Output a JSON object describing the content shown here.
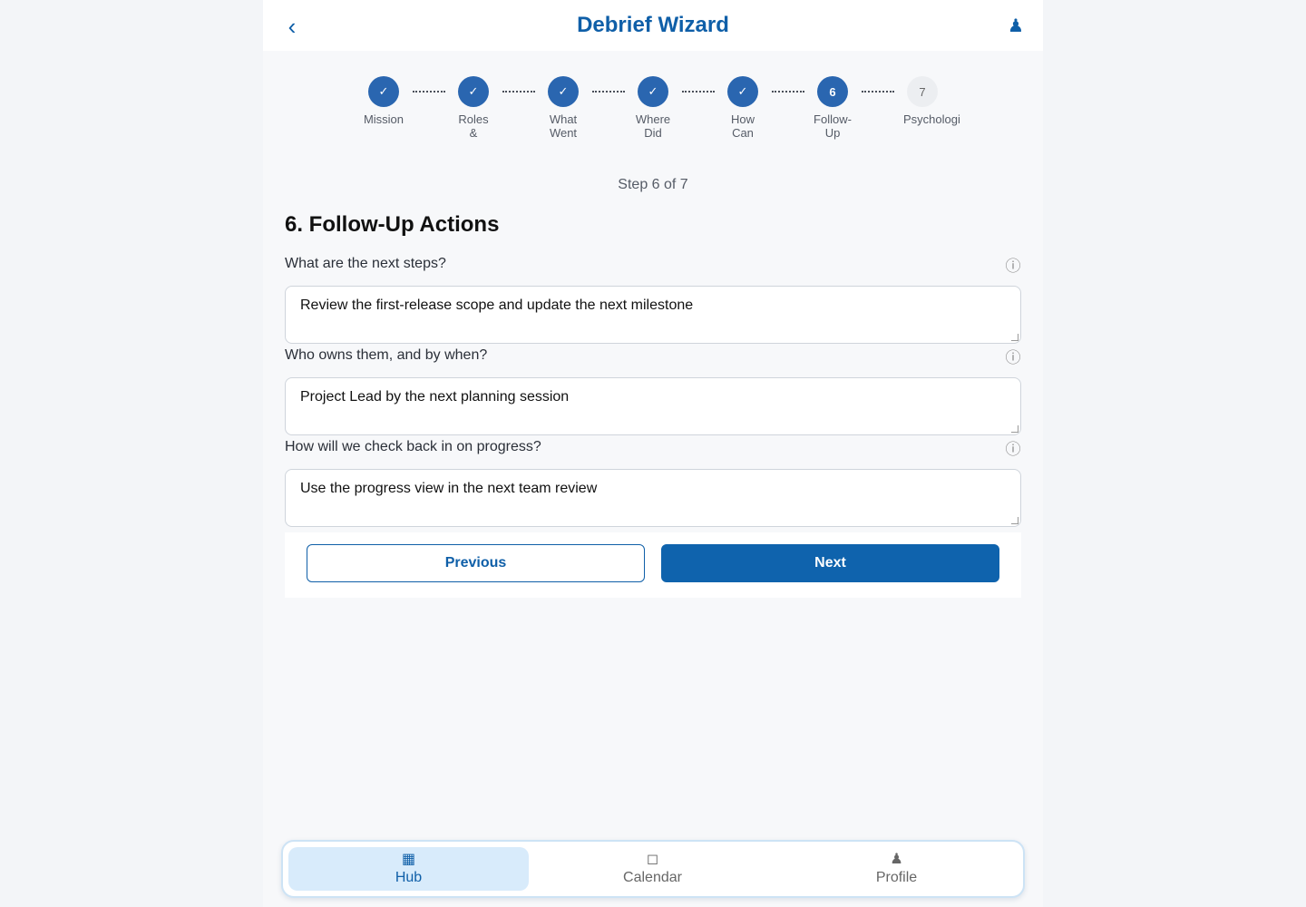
{
  "header": {
    "back_icon": "‹",
    "title": "Debrief Wizard",
    "profile_icon": "♟"
  },
  "stepper": {
    "steps": [
      {
        "marker": "✓",
        "label": "Mission",
        "state": "done"
      },
      {
        "marker": "✓",
        "label": "Roles &",
        "state": "done"
      },
      {
        "marker": "✓",
        "label": "What Went",
        "state": "done"
      },
      {
        "marker": "✓",
        "label": "Where Did",
        "state": "done"
      },
      {
        "marker": "✓",
        "label": "How Can",
        "state": "done"
      },
      {
        "marker": "6",
        "label": "Follow-Up",
        "state": "current"
      },
      {
        "marker": "7",
        "label": "Psychologi",
        "state": "pending"
      }
    ],
    "step_count": "Step 6 of 7"
  },
  "section": {
    "title": "6. Follow-Up Actions",
    "questions": [
      {
        "label": "What are the next steps?",
        "value": "Review the first-release scope and update the next milestone",
        "info_icon": "ⓘ"
      },
      {
        "label": "Who owns them, and by when?",
        "value": "Project Lead by the next planning session",
        "info_icon": "ⓘ"
      },
      {
        "label": "How will we check back in on progress?",
        "value": "Use the progress view in the next team review",
        "info_icon": "ⓘ"
      }
    ]
  },
  "actions": {
    "previous_label": "Previous",
    "next_label": "Next"
  },
  "bottom_nav": {
    "tabs": [
      {
        "icon": "▦",
        "label": "Hub",
        "active": true
      },
      {
        "icon": "◻",
        "label": "Calendar",
        "active": false
      },
      {
        "icon": "♟",
        "label": "Profile",
        "active": false
      }
    ]
  },
  "colors": {
    "accent": "#0f5fa8",
    "step_done": "#2a66b0",
    "active_tab_bg": "#d8ebfb"
  }
}
